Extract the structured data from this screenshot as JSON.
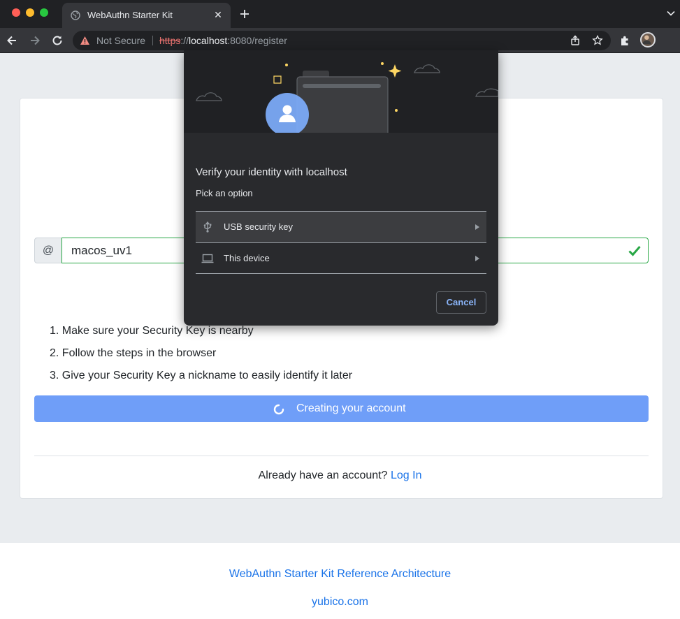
{
  "browser": {
    "tab_title": "WebAuthn Starter Kit",
    "tab_close": "✕",
    "security_label": "Not Secure",
    "url_scheme": "https",
    "url_separator": "://",
    "url_host": "localhost",
    "url_rest": ":8080/register"
  },
  "form": {
    "at_symbol": "@",
    "username_value": "macos_uv1"
  },
  "steps": [
    "1. Make sure your Security Key is nearby",
    "2. Follow the steps in the browser",
    "3. Give your Security Key a nickname to easily identify it later"
  ],
  "create_button_label": "Creating your account",
  "login": {
    "prompt": "Already have an account?",
    "link": "Log In"
  },
  "footer": {
    "reference_link": "WebAuthn Starter Kit Reference Architecture",
    "site_link": "yubico.com"
  },
  "dialog": {
    "title": "Verify your identity with localhost",
    "subtitle": "Pick an option",
    "options": [
      {
        "label": "USB security key",
        "icon": "usb-icon"
      },
      {
        "label": "This device",
        "icon": "laptop-icon"
      }
    ],
    "cancel_label": "Cancel"
  },
  "colors": {
    "accent_button": "#6f9ef8",
    "link": "#1a73e8",
    "valid": "#28a745",
    "dialog_bg": "#292a2d",
    "dialog_link": "#8ab4f8"
  }
}
